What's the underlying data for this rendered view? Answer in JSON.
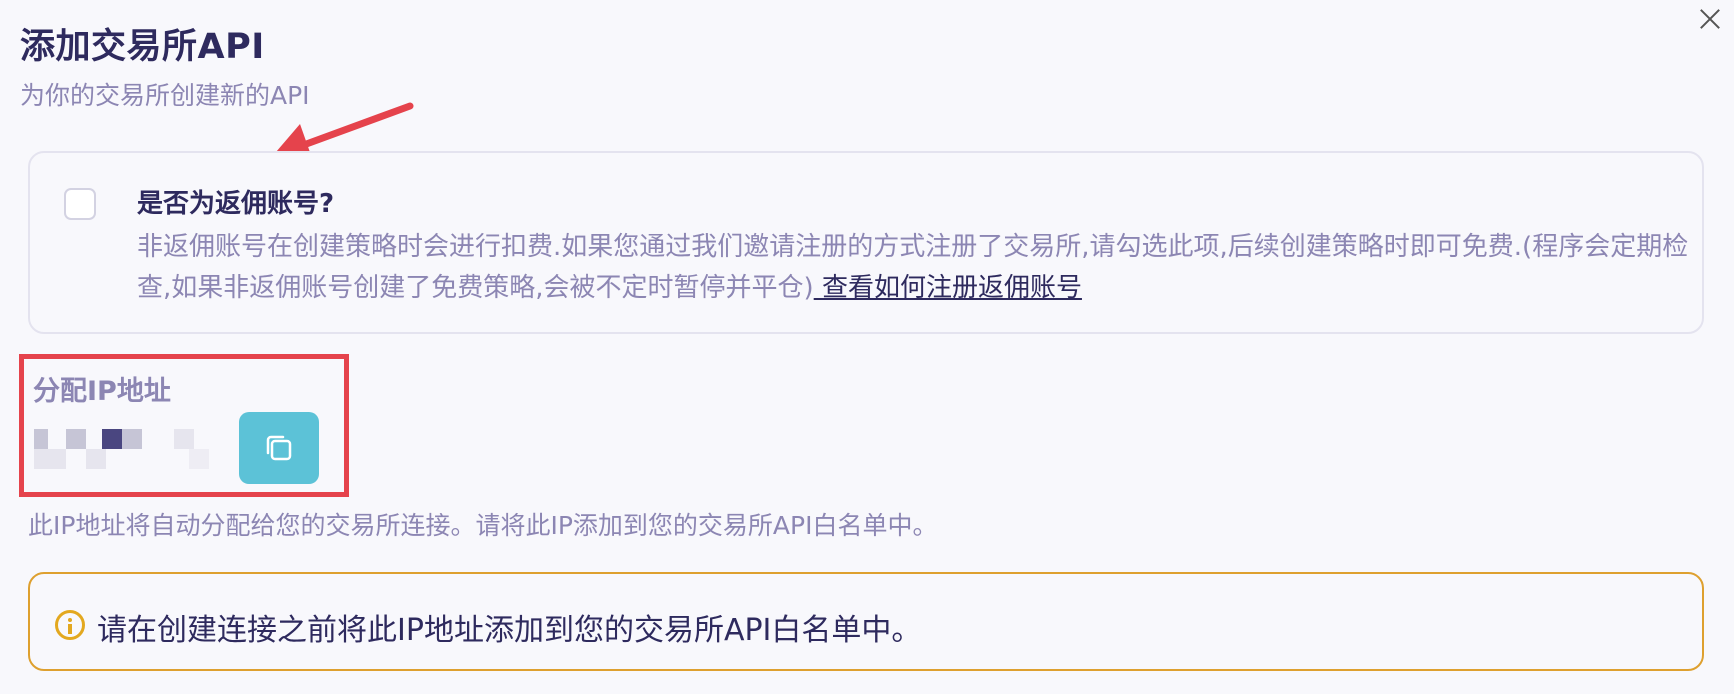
{
  "dialog": {
    "title": "添加交易所API",
    "subtitle": "为你的交易所创建新的API",
    "close_label": "×"
  },
  "rebate": {
    "title": "是否为返佣账号?",
    "description": "非返佣账号在创建策略时会进行扣费.如果您通过我们邀请注册的方式注册了交易所,请勾选此项,后续创建策略时即可免费.(程序会定期检查,如果非返佣账号创建了免费策略,会被不定时暂停并平仓)",
    "link": " 查看如何注册返佣账号",
    "checked": false
  },
  "ip": {
    "label": "分配IP地址",
    "note": "此IP地址将自动分配给您的交易所连接。请将此IP添加到您的交易所API白名单中。",
    "copy_icon": "copy-icon"
  },
  "warning": {
    "text": "请在创建连接之前将此IP地址添加到您的交易所API白名单中。",
    "icon": "info-icon"
  },
  "colors": {
    "primary_text": "#2e2a5e",
    "muted_text": "#8c86b3",
    "accent": "#5cc2d7",
    "warning": "#dea02f",
    "highlight": "#e5434c"
  }
}
